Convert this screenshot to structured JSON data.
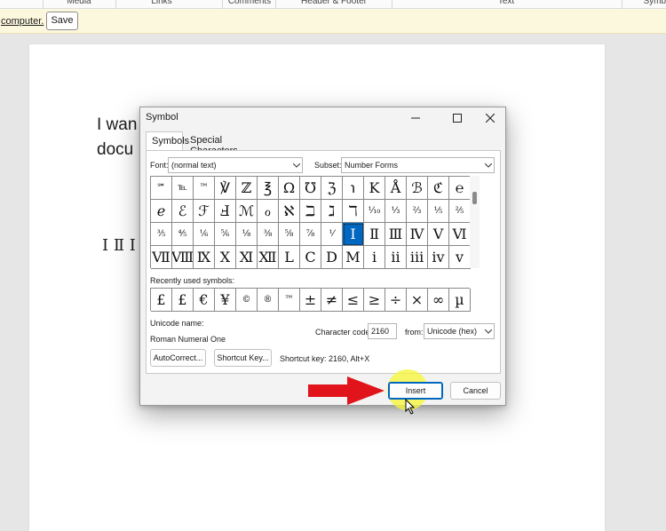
{
  "ribbon": {
    "groups": [
      "Media",
      "Links",
      "Comments",
      "Header & Footer",
      "Text",
      "Symb"
    ]
  },
  "infobar": {
    "text": "computer.",
    "save_label": "Save"
  },
  "document": {
    "line1": "I wan",
    "line2": "docu",
    "numerals": "Ⅰ Ⅱ Ⅰ"
  },
  "dialog": {
    "title": "Symbol",
    "tabs": [
      "Symbols",
      "Special Characters"
    ],
    "font_label": "Font:",
    "font_value": "(normal text)",
    "subset_label": "Subset:",
    "subset_value": "Number Forms",
    "grid_symbols": [
      [
        "℠",
        "℡",
        "™",
        "℣",
        "ℤ",
        "℥",
        "Ω",
        "℧",
        "ℨ",
        "℩",
        "K",
        "Å",
        "ℬ",
        "ℭ",
        "℮"
      ],
      [
        "ℯ",
        "ℰ",
        "ℱ",
        "Ⅎ",
        "ℳ",
        "ℴ",
        "ℵ",
        "ℶ",
        "ℷ",
        "ℸ",
        "⅒",
        "⅓",
        "⅔",
        "⅕",
        "⅖"
      ],
      [
        "⅗",
        "⅘",
        "⅙",
        "⅚",
        "⅛",
        "⅜",
        "⅝",
        "⅞",
        "⅟",
        "Ⅰ",
        "Ⅱ",
        "Ⅲ",
        "Ⅳ",
        "Ⅴ",
        "Ⅵ"
      ],
      [
        "Ⅶ",
        "Ⅷ",
        "Ⅸ",
        "Ⅹ",
        "Ⅺ",
        "Ⅻ",
        "Ⅼ",
        "Ⅽ",
        "Ⅾ",
        "Ⅿ",
        "ⅰ",
        "ⅱ",
        "ⅲ",
        "ⅳ",
        "ⅴ"
      ]
    ],
    "selected_symbol": "Ⅰ",
    "recent_label": "Recently used symbols:",
    "recent_symbols": [
      "£",
      "£",
      "€",
      "¥",
      "©",
      "®",
      "™",
      "±",
      "≠",
      "≤",
      "≥",
      "÷",
      "×",
      "∞",
      "µ"
    ],
    "unicode_name_label": "Unicode name:",
    "unicode_name": "Roman Numeral One",
    "char_code_label": "Character code:",
    "char_code_value": "2160",
    "from_label": "from:",
    "from_value": "Unicode (hex)",
    "autocorrect_label": "AutoCorrect...",
    "shortcut_key_label": "Shortcut Key...",
    "shortcut_text": "Shortcut key: 2160, Alt+X",
    "insert_label": "Insert",
    "cancel_label": "Cancel"
  },
  "colors": {
    "selection": "#0067c0",
    "infobar": "#fcf8de",
    "arrow": "#e0141a",
    "highlight": "#f6f63c"
  },
  "icons": [
    "minimize-icon",
    "maximize-icon",
    "close-icon",
    "chevron-down-icon",
    "red-arrow-icon",
    "mouse-cursor-icon"
  ]
}
